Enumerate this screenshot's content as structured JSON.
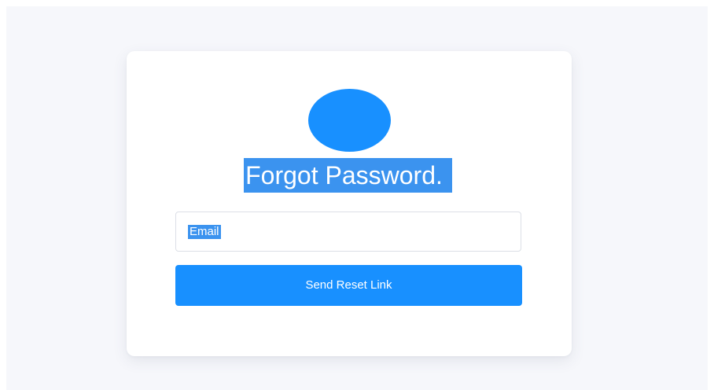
{
  "colors": {
    "page_background": "#f6f7fb",
    "card_background": "#ffffff",
    "accent": "#1890ff",
    "selection_highlight": "#3b93ef"
  },
  "header": {
    "avatar_icon": "circle-avatar",
    "title": "Forgot Password."
  },
  "form": {
    "email_placeholder": "Email",
    "submit_label": "Send Reset Link"
  }
}
